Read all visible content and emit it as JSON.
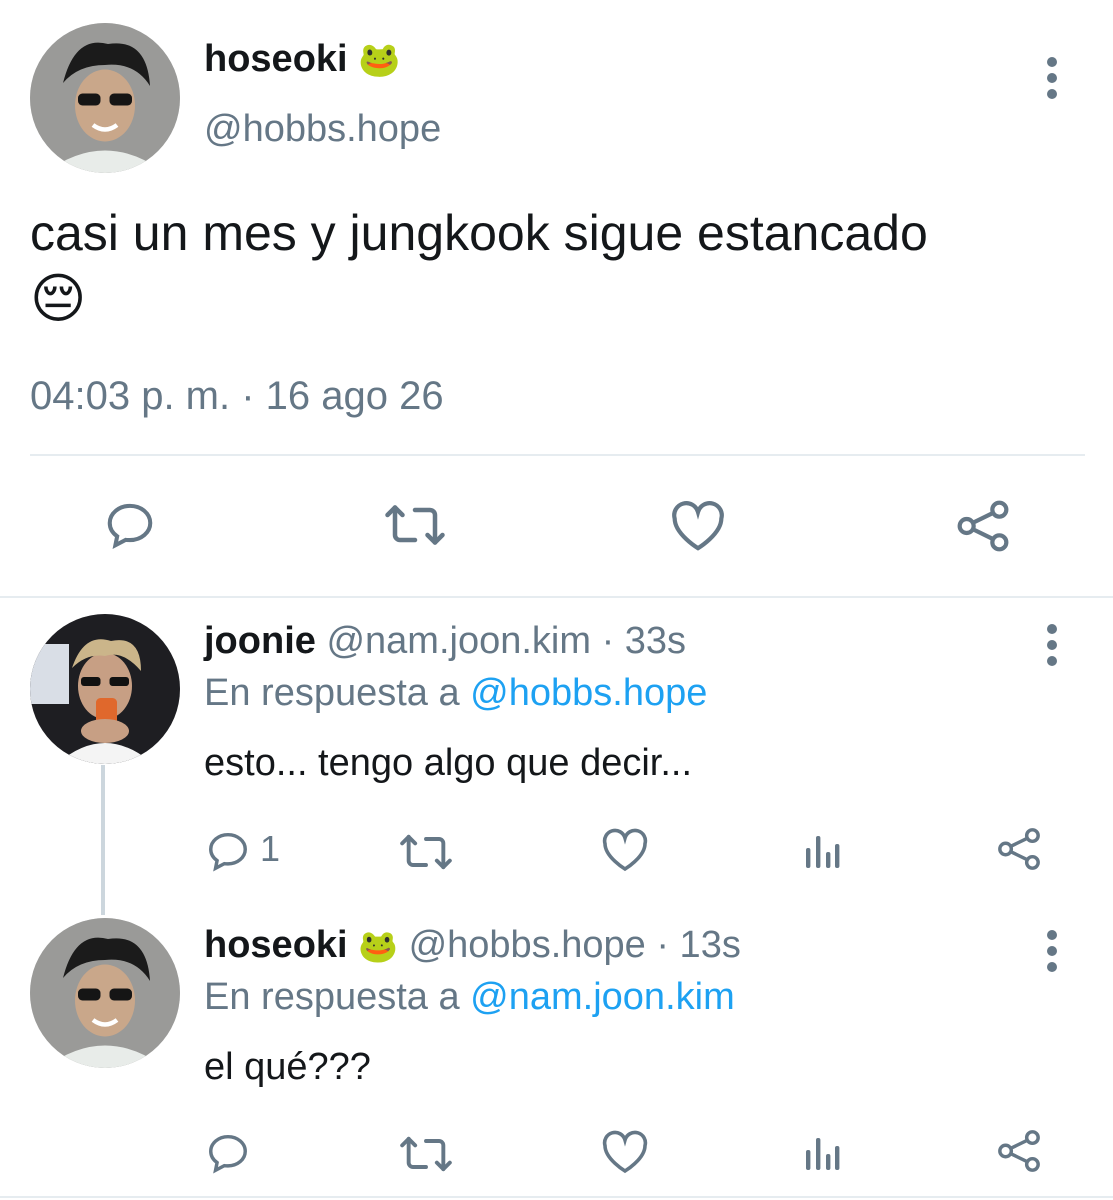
{
  "main_tweet": {
    "name": "hoseoki",
    "emoji": "🐸",
    "handle": "@hobbs.hope",
    "text": "casi un mes y jungkook sigue estancado",
    "text_emoji": "😔",
    "timestamp": "04:03 p. m. · 16 ago 26"
  },
  "replies": [
    {
      "name": "joonie",
      "handle": "@nam.joon.kim",
      "time": "· 33s",
      "reply_prefix": "En respuesta a",
      "reply_to": "@hobbs.hope",
      "text": "esto... tengo algo que decir...",
      "reply_count": "1"
    },
    {
      "name": "hoseoki",
      "emoji": "🐸",
      "handle": "@hobbs.hope",
      "time": "· 13s",
      "reply_prefix": "En respuesta a",
      "reply_to": "@nam.joon.kim",
      "text": "el qué???",
      "reply_count": ""
    }
  ],
  "icons": {
    "reply": "reply-icon",
    "retweet": "retweet-icon",
    "like": "heart-icon",
    "share": "share-icon",
    "analytics": "analytics-icon",
    "more": "more-vertical-icon"
  },
  "colors": {
    "text": "#14171a",
    "muted": "#657786",
    "link": "#1da1f2",
    "divider": "#e6ecf0"
  }
}
